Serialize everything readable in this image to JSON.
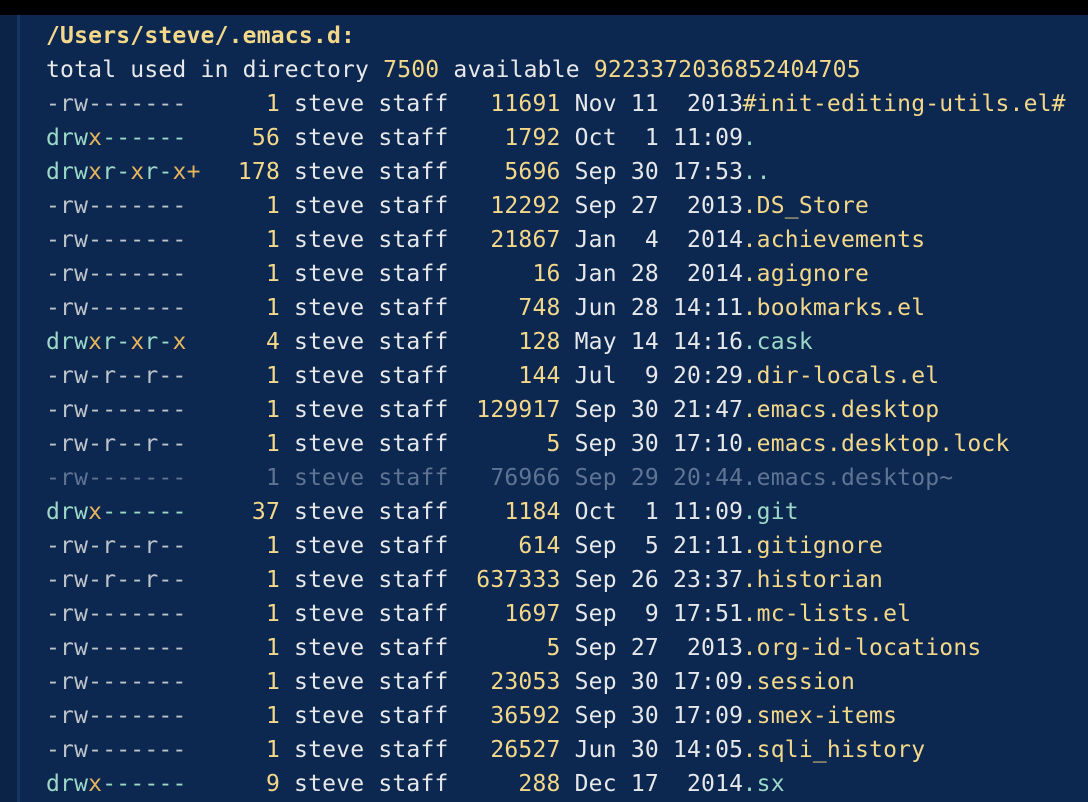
{
  "buffer": {
    "header": "/Users/steve/.emacs.d:",
    "summary": {
      "prefix": "total used in directory ",
      "used": "7500",
      "mid": " available ",
      "available": "9223372036852404705"
    },
    "entries": [
      {
        "perm": "-rw-------",
        "links": "1",
        "owner": "steve staff",
        "size": "11691",
        "date": "Nov 11  2013",
        "name": "#init-editing-utils.el#",
        "kind": "file"
      },
      {
        "perm": "drwx------",
        "links": "56",
        "owner": "steve staff",
        "size": "1792",
        "date": "Oct  1 11:09",
        "name": ".",
        "kind": "dir"
      },
      {
        "perm": "drwxr-xr-x+",
        "links": "178",
        "owner": "steve staff",
        "size": "5696",
        "date": "Sep 30 17:53",
        "name": "..",
        "kind": "dir"
      },
      {
        "perm": "-rw-------",
        "links": "1",
        "owner": "steve staff",
        "size": "12292",
        "date": "Sep 27  2013",
        "name": ".DS_Store",
        "kind": "file"
      },
      {
        "perm": "-rw-------",
        "links": "1",
        "owner": "steve staff",
        "size": "21867",
        "date": "Jan  4  2014",
        "name": ".achievements",
        "kind": "file"
      },
      {
        "perm": "-rw-------",
        "links": "1",
        "owner": "steve staff",
        "size": "16",
        "date": "Jan 28  2014",
        "name": ".agignore",
        "kind": "file"
      },
      {
        "perm": "-rw-------",
        "links": "1",
        "owner": "steve staff",
        "size": "748",
        "date": "Jun 28 14:11",
        "name": ".bookmarks.el",
        "kind": "file"
      },
      {
        "perm": "drwxr-xr-x",
        "links": "4",
        "owner": "steve staff",
        "size": "128",
        "date": "May 14 14:16",
        "name": ".cask",
        "kind": "dir"
      },
      {
        "perm": "-rw-r--r--",
        "links": "1",
        "owner": "steve staff",
        "size": "144",
        "date": "Jul  9 20:29",
        "name": ".dir-locals.el",
        "kind": "file"
      },
      {
        "perm": "-rw-------",
        "links": "1",
        "owner": "steve staff",
        "size": "129917",
        "date": "Sep 30 21:47",
        "name": ".emacs.desktop",
        "kind": "file"
      },
      {
        "perm": "-rw-r--r--",
        "links": "1",
        "owner": "steve staff",
        "size": "5",
        "date": "Sep 30 17:10",
        "name": ".emacs.desktop.lock",
        "kind": "file"
      },
      {
        "perm": "-rw-------",
        "links": "1",
        "owner": "steve staff",
        "size": "76966",
        "date": "Sep 29 20:44",
        "name": ".emacs.desktop~",
        "kind": "backup"
      },
      {
        "perm": "drwx------",
        "links": "37",
        "owner": "steve staff",
        "size": "1184",
        "date": "Oct  1 11:09",
        "name": ".git",
        "kind": "dir"
      },
      {
        "perm": "-rw-r--r--",
        "links": "1",
        "owner": "steve staff",
        "size": "614",
        "date": "Sep  5 21:11",
        "name": ".gitignore",
        "kind": "file"
      },
      {
        "perm": "-rw-r--r--",
        "links": "1",
        "owner": "steve staff",
        "size": "637333",
        "date": "Sep 26 23:37",
        "name": ".historian",
        "kind": "file"
      },
      {
        "perm": "-rw-------",
        "links": "1",
        "owner": "steve staff",
        "size": "1697",
        "date": "Sep  9 17:51",
        "name": ".mc-lists.el",
        "kind": "file"
      },
      {
        "perm": "-rw-------",
        "links": "1",
        "owner": "steve staff",
        "size": "5",
        "date": "Sep 27  2013",
        "name": ".org-id-locations",
        "kind": "file"
      },
      {
        "perm": "-rw-------",
        "links": "1",
        "owner": "steve staff",
        "size": "23053",
        "date": "Sep 30 17:09",
        "name": ".session",
        "kind": "file"
      },
      {
        "perm": "-rw-------",
        "links": "1",
        "owner": "steve staff",
        "size": "36592",
        "date": "Sep 30 17:09",
        "name": ".smex-items",
        "kind": "file"
      },
      {
        "perm": "-rw-------",
        "links": "1",
        "owner": "steve staff",
        "size": "26527",
        "date": "Jun 30 14:05",
        "name": ".sqli_history",
        "kind": "file"
      },
      {
        "perm": "drwx------",
        "links": "9",
        "owner": "steve staff",
        "size": "288",
        "date": "Dec 17  2014",
        "name": ".sx",
        "kind": "dir"
      }
    ]
  },
  "colors": {
    "background": "#0c2850",
    "header": "#f4d88a",
    "number": "#f4d88a",
    "directory": "#9cd9c8",
    "executable_bit": "#e6b45c",
    "text": "#e6e8ea",
    "backup": "#5f7493"
  }
}
